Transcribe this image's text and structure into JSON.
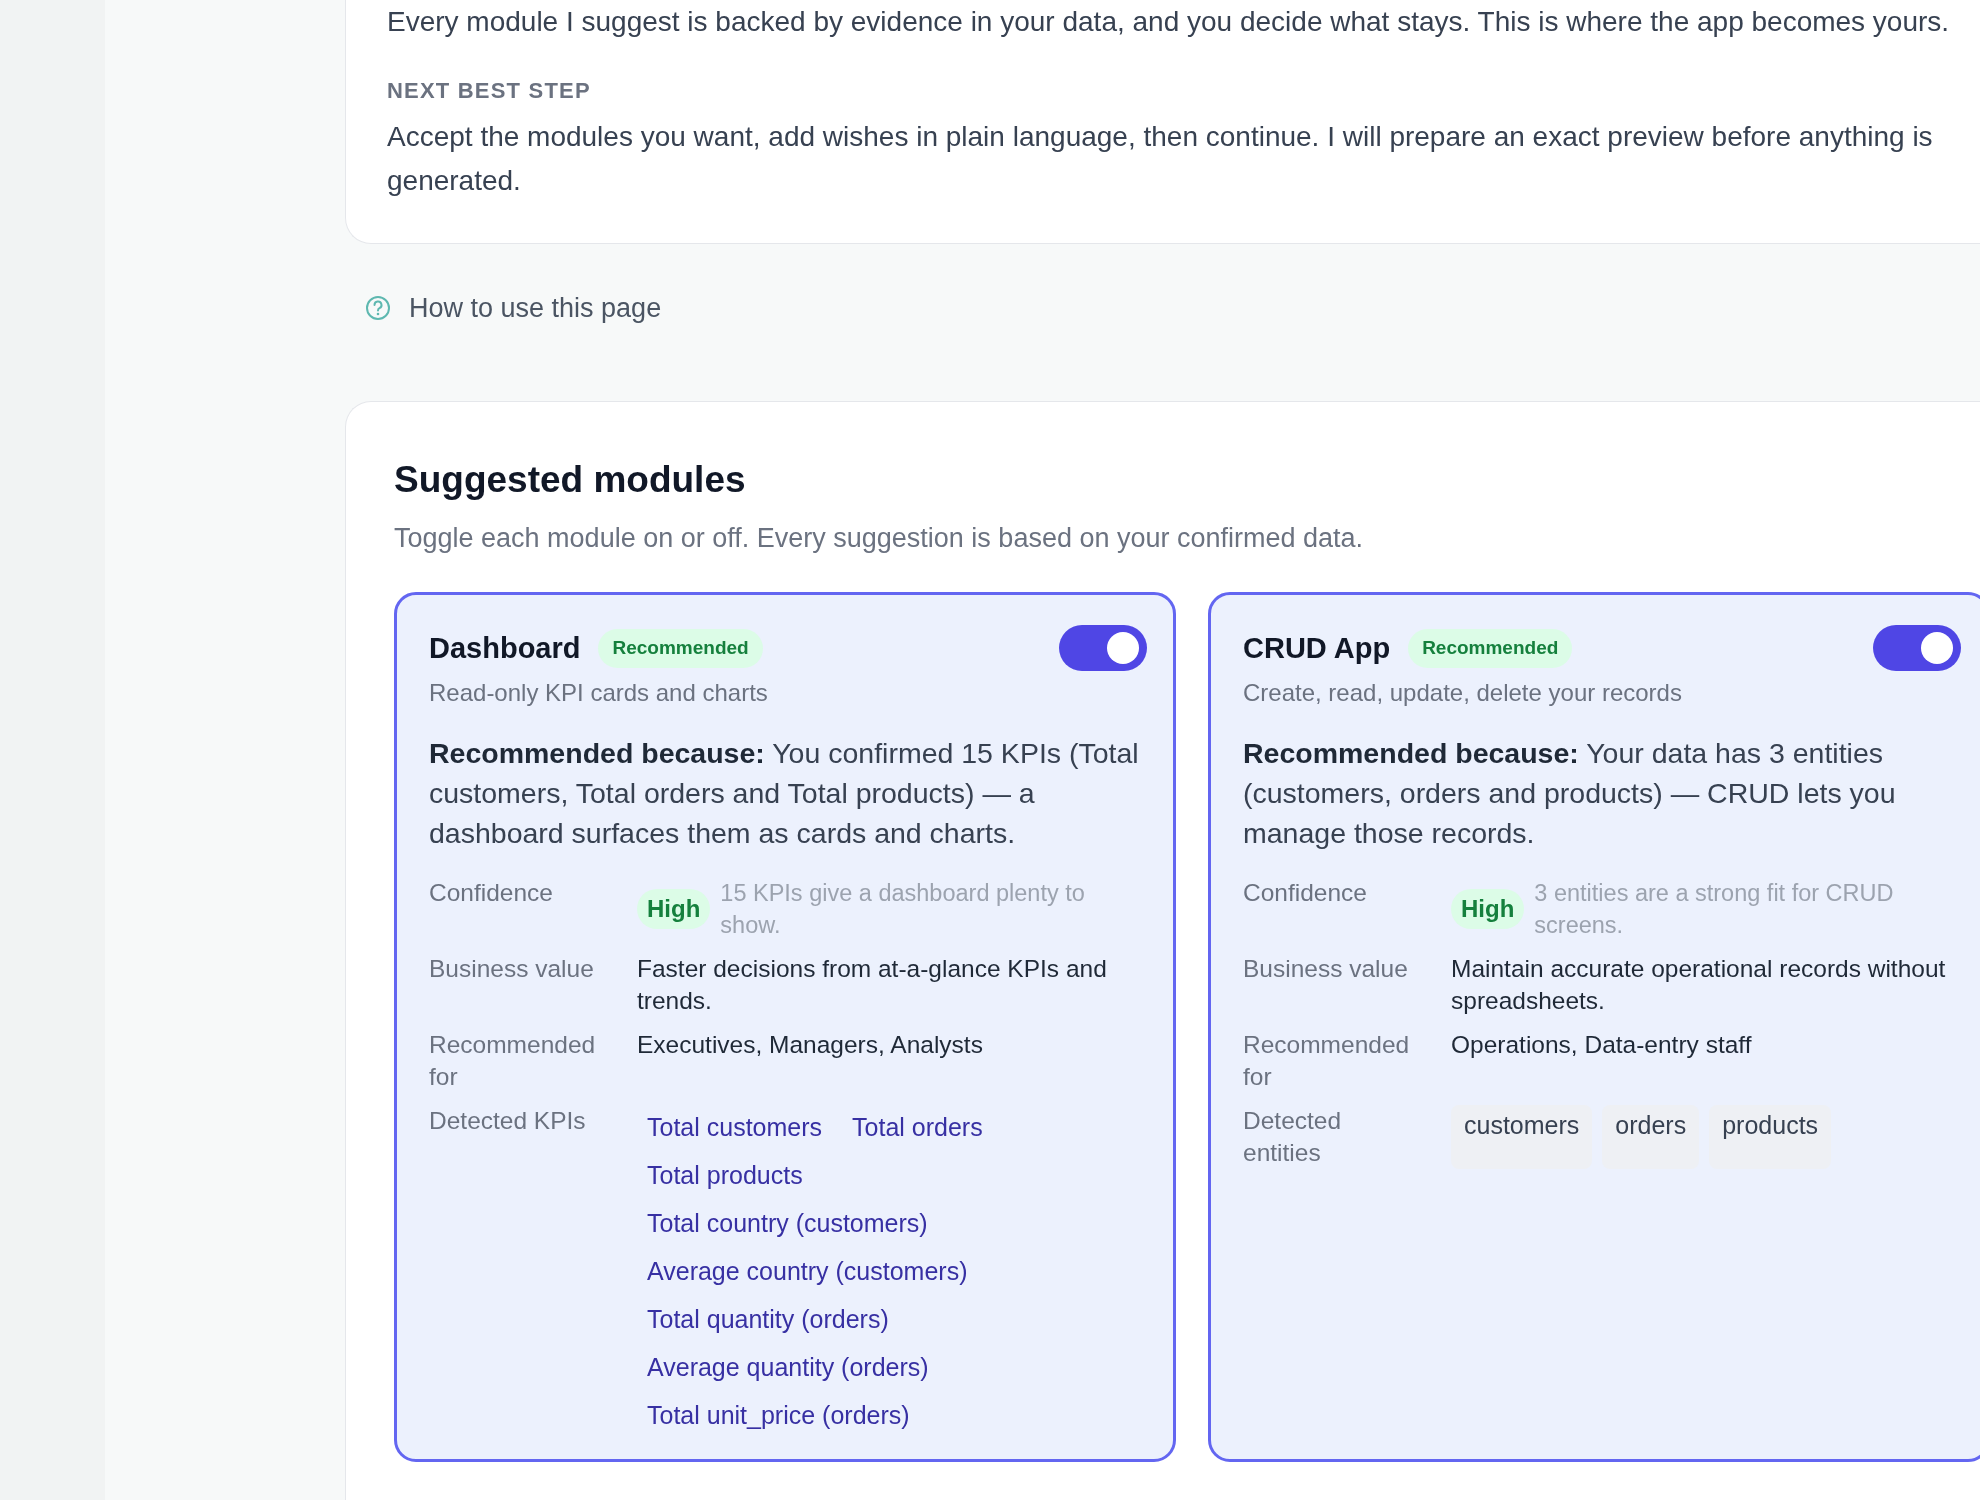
{
  "intro": {
    "text": "Every module I suggest is backed by evidence in your data, and you decide what stays. This is where the app becomes yours.",
    "next_step_label": "NEXT BEST STEP",
    "next_step_text": "Accept the modules you want, add wishes in plain language, then continue. I will prepare an exact preview before anything is generated."
  },
  "help_link": "How to use this page",
  "suggested": {
    "title": "Suggested modules",
    "subtitle": "Toggle each module on or off. Every suggestion is based on your confirmed data.",
    "modules": [
      {
        "name": "Dashboard",
        "badge": "Recommended",
        "enabled": true,
        "description": "Read-only KPI cards and charts",
        "reason": "**Recommended because:** You confirmed 15 KPIs (Total customers, Total orders and Total products) — a dashboard surfaces them as cards and charts.",
        "confidence_label": "Confidence",
        "confidence": "High",
        "confidence_note": "15 KPIs give a dashboard plenty to show.",
        "business_value_label": "Business value",
        "business_value": "Faster decisions from at-a-glance KPIs and trends.",
        "recommended_for_label": "Recommended for",
        "recommended_for": "Executives, Managers, Analysts",
        "detected_label": "Detected KPIs",
        "kind": "link",
        "detected": [
          "Total customers",
          "Total orders",
          "Total products",
          "Total country (customers)",
          "Average country (customers)",
          "Total quantity (orders)",
          "Average quantity (orders)",
          "Total unit_price (orders)"
        ]
      },
      {
        "name": "CRUD App",
        "badge": "Recommended",
        "enabled": true,
        "description": "Create, read, update, delete your records",
        "reason": "**Recommended because:** Your data has 3 entities (customers, orders and products) — CRUD lets you manage those records.",
        "confidence_label": "Confidence",
        "confidence": "High",
        "confidence_note": "3 entities are a strong fit for CRUD screens.",
        "business_value_label": "Business value",
        "business_value": "Maintain accurate operational records without spreadsheets.",
        "recommended_for_label": "Recommended for",
        "recommended_for": "Operations, Data-entry staff",
        "detected_label": "Detected entities",
        "kind": "chip",
        "detected": [
          "customers",
          "orders",
          "products"
        ]
      }
    ]
  }
}
